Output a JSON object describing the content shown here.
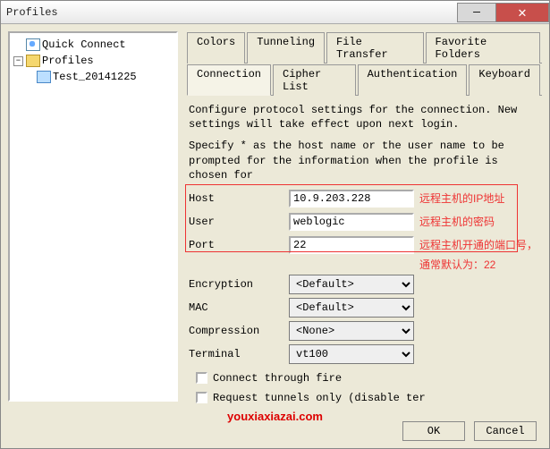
{
  "window": {
    "title": "Profiles"
  },
  "tree": {
    "quick": "Quick Connect",
    "profiles": "Profiles",
    "item1": "Test_20141225"
  },
  "tabs_row1": [
    "Colors",
    "Tunneling",
    "File Transfer",
    "Favorite Folders"
  ],
  "tabs_row2": [
    "Connection",
    "Cipher List",
    "Authentication",
    "Keyboard"
  ],
  "active_tab": "Connection",
  "desc1": "Configure protocol settings for the connection. New settings will take effect upon next login.",
  "desc2": "Specify * as the host name or the user name to be prompted for the information when the profile is chosen for",
  "fields": {
    "host": {
      "label": "Host",
      "value": "10.9.203.228",
      "annot": "远程主机的IP地址"
    },
    "user": {
      "label": "User",
      "value": "weblogic",
      "annot": "远程主机的密码"
    },
    "port": {
      "label": "Port",
      "value": "22",
      "annot": "远程主机开通的端口号，"
    },
    "port_annot2": "通常默认为：22",
    "encryption": {
      "label": "Encryption",
      "value": "<Default>"
    },
    "mac": {
      "label": "MAC",
      "value": "<Default>"
    },
    "compression": {
      "label": "Compression",
      "value": "<None>"
    },
    "terminal": {
      "label": "Terminal",
      "value": "vt100"
    }
  },
  "chk1": "Connect through fire",
  "chk2": "Request tunnels only (disable ter",
  "buttons": {
    "ok": "OK",
    "cancel": "Cancel"
  },
  "watermark": "youxiaxiazai.com",
  "wm2": ""
}
